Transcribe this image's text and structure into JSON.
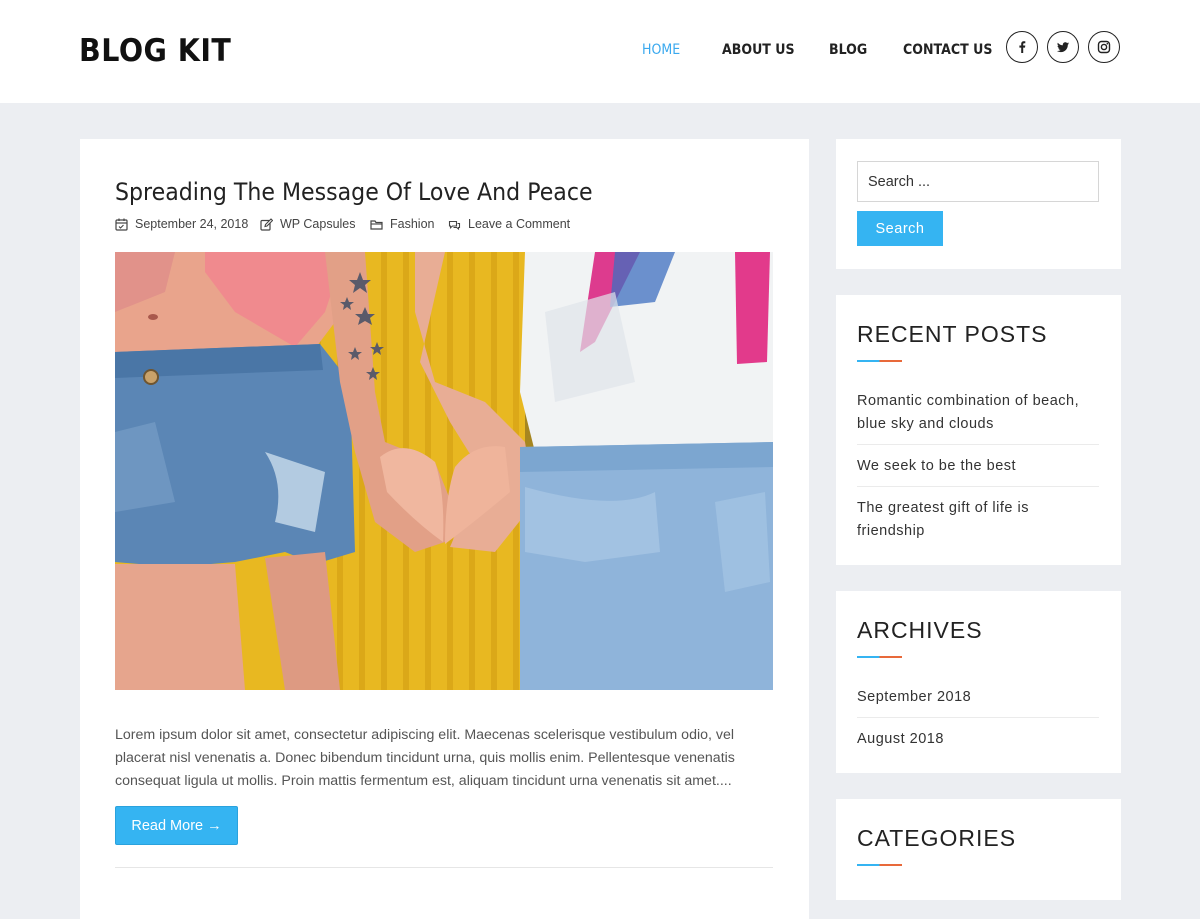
{
  "site": {
    "logo": "BLOG KIT"
  },
  "nav": {
    "items": [
      {
        "label": "HOME",
        "active": true
      },
      {
        "label": "ABOUT US",
        "active": false
      },
      {
        "label": "BLOG",
        "active": false
      },
      {
        "label": "CONTACT US",
        "active": false
      }
    ],
    "social": [
      "facebook-icon",
      "twitter-icon",
      "instagram-icon"
    ]
  },
  "post": {
    "title": "Spreading The Message Of Love And Peace",
    "date": "September 24, 2018",
    "author": "WP Capsules",
    "category": "Fashion",
    "comments": "Leave a Comment",
    "excerpt": "Lorem ipsum dolor sit amet, consectetur adipiscing elit. Maecenas scelerisque vestibulum odio, vel placerat nisl venenatis a. Donec bibendum tincidunt urna, quis mollis enim. Pellentesque venenatis consequat ligula ut mollis. Proin mattis fermentum est, aliquam tincidunt urna venenatis sit amet....",
    "read_more": "Read More →"
  },
  "sidebar": {
    "search": {
      "placeholder": "Search ...",
      "button": "Search"
    },
    "recent_posts": {
      "title": "RECENT POSTS",
      "items": [
        "Romantic combination of beach, blue sky and clouds",
        "We seek to be the best",
        "The greatest gift of life is friendship"
      ]
    },
    "archives": {
      "title": "ARCHIVES",
      "items": [
        "September 2018",
        "August 2018"
      ]
    },
    "categories": {
      "title": "CATEGORIES"
    }
  },
  "colors": {
    "accent": "#35b4f2",
    "accent_secondary": "#e8693a",
    "nav_active": "#3aa9ef",
    "page_bg": "#eceef2"
  }
}
